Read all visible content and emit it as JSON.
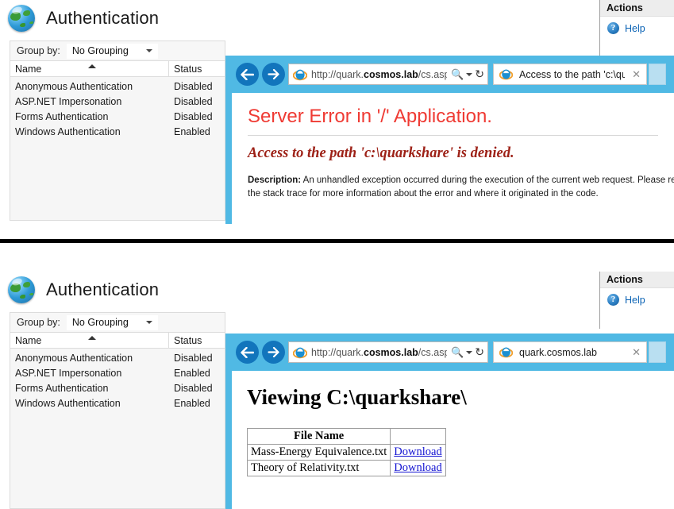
{
  "colors": {
    "ie_chrome": "#50b9e4",
    "nav_button": "#1275bc",
    "error_heading": "#ef3a33",
    "error_subheading": "#9d2117",
    "link": "#1414d2",
    "help_link": "#0b63b5",
    "divider": "#000000"
  },
  "captures": [
    {
      "id": "top",
      "iis": {
        "page_title": "Authentication",
        "globe_icon": "globe-icon",
        "toolbar": {
          "group_by_label": "Group by:",
          "group_by_value": "No Grouping",
          "dropdown_icon": "chevron-down-icon"
        },
        "columns": [
          "Name",
          "Status"
        ],
        "sort_icon": "sort-ascending-icon",
        "rows": [
          {
            "name": "Anonymous Authentication",
            "status": "Disabled"
          },
          {
            "name": "ASP.NET Impersonation",
            "status": "Disabled"
          },
          {
            "name": "Forms Authentication",
            "status": "Disabled"
          },
          {
            "name": "Windows Authentication",
            "status": "Enabled"
          }
        ]
      },
      "actions": {
        "header": "Actions",
        "help_icon": "help-question-icon",
        "help_label": "Help"
      },
      "browser": {
        "back_icon": "arrow-left-icon",
        "forward_icon": "arrow-right-icon",
        "favicon": "internet-explorer-icon",
        "url_prefix": "http://quark.",
        "url_domain": "cosmos.lab",
        "url_suffix": "/cs.aspx",
        "search_icon": "magnifier-icon",
        "dropdown_icon": "chevron-down-icon",
        "refresh_icon": "refresh-icon",
        "tab_title": "Access to the path 'c:\\quar...",
        "tab_close_icon": "close-icon"
      },
      "page": {
        "kind": "error",
        "heading": "Server Error in '/' Application.",
        "subheading": "Access to the path 'c:\\quarkshare' is denied.",
        "description_label": "Description:",
        "description_text": " An unhandled exception occurred during the execution of the current web request. Please review the stack trace for more information about the error and where it originated in the code."
      }
    },
    {
      "id": "bottom",
      "iis": {
        "page_title": "Authentication",
        "globe_icon": "globe-icon",
        "toolbar": {
          "group_by_label": "Group by:",
          "group_by_value": "No Grouping",
          "dropdown_icon": "chevron-down-icon"
        },
        "columns": [
          "Name",
          "Status"
        ],
        "sort_icon": "sort-ascending-icon",
        "rows": [
          {
            "name": "Anonymous Authentication",
            "status": "Disabled"
          },
          {
            "name": "ASP.NET Impersonation",
            "status": "Enabled"
          },
          {
            "name": "Forms Authentication",
            "status": "Disabled"
          },
          {
            "name": "Windows Authentication",
            "status": "Enabled"
          }
        ]
      },
      "actions": {
        "header": "Actions",
        "help_icon": "help-question-icon",
        "help_label": "Help"
      },
      "browser": {
        "back_icon": "arrow-left-icon",
        "forward_icon": "arrow-right-icon",
        "favicon": "internet-explorer-icon",
        "url_prefix": "http://quark.",
        "url_domain": "cosmos.lab",
        "url_suffix": "/cs.aspx",
        "search_icon": "magnifier-icon",
        "dropdown_icon": "chevron-down-icon",
        "refresh_icon": "refresh-icon",
        "tab_title": "quark.cosmos.lab",
        "tab_close_icon": "close-icon"
      },
      "page": {
        "kind": "listing",
        "heading": "Viewing C:\\quarkshare\\",
        "table": {
          "headers": [
            "File Name",
            ""
          ],
          "rows": [
            {
              "file_name": "Mass-Energy Equivalence.txt",
              "action": "Download"
            },
            {
              "file_name": "Theory of Relativity.txt",
              "action": "Download"
            }
          ]
        }
      }
    }
  ]
}
